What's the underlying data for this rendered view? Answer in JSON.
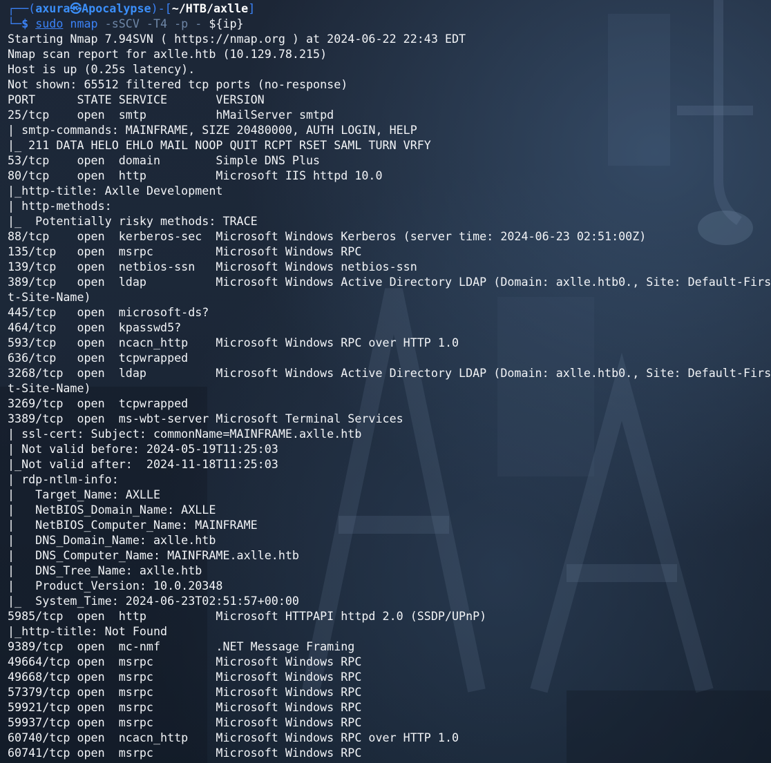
{
  "prompt": {
    "corner_top": "┌──(",
    "user": "axura",
    "at_symbol": "㉿",
    "host": "Apocalypse",
    "mid": ")-[",
    "path": "~/HTB/axlle",
    "end": "]",
    "corner_bottom": "└─",
    "dollar": "$ ",
    "command": "sudo",
    "program": " nmap",
    "args": " -sSCV -T4 -p - ",
    "variable_prefix": "$",
    "variable": "{ip}"
  },
  "output_lines": [
    "Starting Nmap 7.94SVN ( https://nmap.org ) at 2024-06-22 22:43 EDT",
    "Nmap scan report for axlle.htb (10.129.78.215)",
    "Host is up (0.25s latency).",
    "Not shown: 65512 filtered tcp ports (no-response)",
    "PORT      STATE SERVICE       VERSION",
    "25/tcp    open  smtp          hMailServer smtpd",
    "| smtp-commands: MAINFRAME, SIZE 20480000, AUTH LOGIN, HELP",
    "|_ 211 DATA HELO EHLO MAIL NOOP QUIT RCPT RSET SAML TURN VRFY",
    "53/tcp    open  domain        Simple DNS Plus",
    "80/tcp    open  http          Microsoft IIS httpd 10.0",
    "|_http-title: Axlle Development",
    "| http-methods:",
    "|_  Potentially risky methods: TRACE",
    "88/tcp    open  kerberos-sec  Microsoft Windows Kerberos (server time: 2024-06-23 02:51:00Z)",
    "135/tcp   open  msrpc         Microsoft Windows RPC",
    "139/tcp   open  netbios-ssn   Microsoft Windows netbios-ssn",
    "389/tcp   open  ldap          Microsoft Windows Active Directory LDAP (Domain: axlle.htb0., Site: Default-Firs",
    "t-Site-Name)",
    "445/tcp   open  microsoft-ds?",
    "464/tcp   open  kpasswd5?",
    "593/tcp   open  ncacn_http    Microsoft Windows RPC over HTTP 1.0",
    "636/tcp   open  tcpwrapped",
    "3268/tcp  open  ldap          Microsoft Windows Active Directory LDAP (Domain: axlle.htb0., Site: Default-Firs",
    "t-Site-Name)",
    "3269/tcp  open  tcpwrapped",
    "3389/tcp  open  ms-wbt-server Microsoft Terminal Services",
    "| ssl-cert: Subject: commonName=MAINFRAME.axlle.htb",
    "| Not valid before: 2024-05-19T11:25:03",
    "|_Not valid after:  2024-11-18T11:25:03",
    "| rdp-ntlm-info:",
    "|   Target_Name: AXLLE",
    "|   NetBIOS_Domain_Name: AXLLE",
    "|   NetBIOS_Computer_Name: MAINFRAME",
    "|   DNS_Domain_Name: axlle.htb",
    "|   DNS_Computer_Name: MAINFRAME.axlle.htb",
    "|   DNS_Tree_Name: axlle.htb",
    "|   Product_Version: 10.0.20348",
    "|_  System_Time: 2024-06-23T02:51:57+00:00",
    "5985/tcp  open  http          Microsoft HTTPAPI httpd 2.0 (SSDP/UPnP)",
    "|_http-title: Not Found",
    "9389/tcp  open  mc-nmf        .NET Message Framing",
    "49664/tcp open  msrpc         Microsoft Windows RPC",
    "49668/tcp open  msrpc         Microsoft Windows RPC",
    "57379/tcp open  msrpc         Microsoft Windows RPC",
    "59921/tcp open  msrpc         Microsoft Windows RPC",
    "59937/tcp open  msrpc         Microsoft Windows RPC",
    "60740/tcp open  ncacn_http    Microsoft Windows RPC over HTTP 1.0",
    "60741/tcp open  msrpc         Microsoft Windows RPC"
  ],
  "colors": {
    "prompt_accent": "#3b82f6",
    "text": "#f2f4f7",
    "background": "#1c2636"
  }
}
